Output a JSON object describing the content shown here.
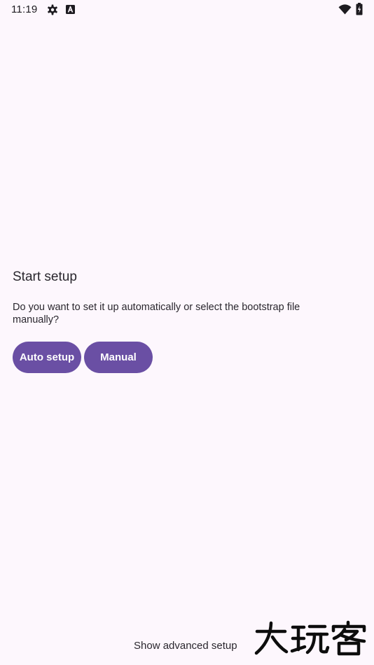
{
  "status_bar": {
    "time": "11:19",
    "icons": [
      "gear-icon",
      "a-notification-icon",
      "wifi-icon",
      "battery-icon"
    ]
  },
  "setup": {
    "title": "Start setup",
    "description": "Do you want to set it up automatically or select the bootstrap file manually?",
    "auto_button_label": "Auto setup",
    "manual_button_label": "Manual"
  },
  "footer": {
    "advanced_label": "Show advanced setup"
  },
  "watermark": {
    "text": "大玩客"
  },
  "colors": {
    "background": "#fdf7fd",
    "primary": "#6a4fa4",
    "on_primary": "#ffffff",
    "text": "#2a272e"
  }
}
